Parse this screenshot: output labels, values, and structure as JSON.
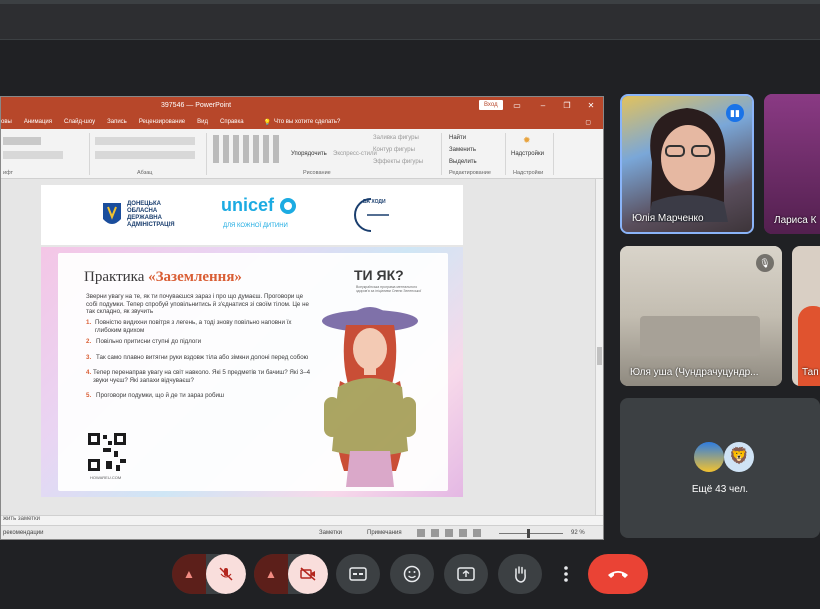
{
  "ppt": {
    "file_name": "397546 — PowerPoint",
    "login_button": "Вход",
    "menu": [
      "овы",
      "Анимация",
      "Слайд-шоу",
      "Запись",
      "Рецензирование",
      "Вид",
      "Справка"
    ],
    "tell_me": "Что вы хотите сделать?",
    "ribbon": {
      "groups": [
        "ифт",
        "Абзац",
        "Рисование",
        "Редактирование",
        "Надстройки"
      ],
      "arrange": "Упорядочить",
      "quick_styles": "Экспресс-стили",
      "shape_fill": "Заливка фигуры",
      "shape_outline": "Контур фигуры",
      "shape_effects": "Эффекты фигуры",
      "find": "Найти",
      "replace": "Заменить",
      "select": "Выделить",
      "addins": "Надстройки"
    },
    "notes": "жить заметки",
    "status": {
      "left": "рекомендации",
      "notes_btn": "Заметки",
      "comments_btn": "Примечания",
      "zoom": "92 %"
    }
  },
  "slide": {
    "org_name": "ДОНЕЦЬКА\nОБЛАСНА\nДЕРЖАВНА\nАДМІНІСТРАЦІЯ",
    "unicef": "unicef",
    "unicef_sub": "ДЛЯ КОЖНОЇ ДИТИНИ",
    "logo3": "ВА ХОДИ",
    "title_plain": "Практика ",
    "title_accent": "«Заземлення»",
    "brand": "ТИ ЯК?",
    "brand_sub": "Всеукраїнська програма ментального здоров'я за ініціативи Олени Зеленської",
    "intro": "Зверни увагу на те, як ти почуваєшся зараз і про що думаєш. Проговори це собі подумки. Тепер спробуй уповільнитись й з'єднатися зі своїм тілом. Це не так складно, як звучить",
    "steps": [
      {
        "n": "1.",
        "t": "Повністю видихни повітря з легень, а тоді знову повільно наповни їх глибоким вдихом"
      },
      {
        "n": "2.",
        "t": "Повільно притисни ступні до підлоги"
      },
      {
        "n": "3.",
        "t": "Так само плавно витягни руки вздовж тіла або зімкни долоні перед собою"
      },
      {
        "n": "4.",
        "t": "Тепер перенаправ увагу на світ навколо. Які 5 предметів ти бачиш? Які 3–4 звуки чуєш? Які запахи відчуваєш?"
      },
      {
        "n": "5.",
        "t": "Проговори подумки, що й де ти зараз робиш"
      }
    ],
    "qr_caption": "HOWAREU.COM"
  },
  "participants": [
    {
      "name": "Юлія Марченко"
    },
    {
      "name": "Лариса К"
    },
    {
      "name": "Юля yшa (Чундрачуцундр..."
    },
    {
      "name": "Тап"
    }
  ],
  "more": {
    "label": "Ещё 43 чел."
  },
  "icons": {
    "mic": "mic-off-icon",
    "cam": "camera-off-icon",
    "captions": "captions-icon",
    "emoji": "emoji-icon",
    "present": "present-icon",
    "hand": "raise-hand-icon",
    "more": "more-vert-icon",
    "end": "end-call-icon"
  },
  "colors": {
    "ppt_accent": "#b7472a",
    "end_call": "#ea4335",
    "active_toggle_bg": "#f9dedc",
    "slide_accent": "#d9582b"
  }
}
